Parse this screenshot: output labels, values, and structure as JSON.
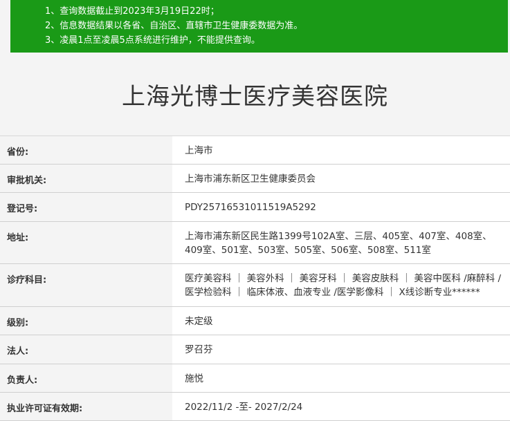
{
  "notice": {
    "lines": [
      "1、查询数据截止到2023年3月19日22时；",
      "2、信息数据结果以各省、自治区、直辖市卫生健康委数据为准。",
      "3、凌晨1点至凌晨5点系统进行维护，不能提供查询。"
    ]
  },
  "title": "上海光博士医疗美容医院",
  "rows": [
    {
      "label": "省份:",
      "value": "上海市"
    },
    {
      "label": "审批机关:",
      "value": "上海市浦东新区卫生健康委员会"
    },
    {
      "label": "登记号:",
      "value": "PDY25716531011519A5292"
    },
    {
      "label": "地址:",
      "value": "上海市浦东新区民生路1399号102A室、三层、405室、407室、408室、409室、501室、503室、505室、506室、508室、511室"
    },
    {
      "label": "诊疗科目:",
      "value": "医疗美容科 ｜ 美容外科 ｜ 美容牙科 ｜ 美容皮肤科 ｜ 美容中医科 /麻醉科 /医学检验科 ｜ 临床体液、血液专业 /医学影像科 ｜ X线诊断专业******"
    },
    {
      "label": "级别:",
      "value": "未定级"
    },
    {
      "label": "法人:",
      "value": "罗召芬"
    },
    {
      "label": "负责人:",
      "value": "施悦"
    },
    {
      "label": "执业许可证有效期:",
      "value": "2022/11/2 -至- 2027/2/24"
    }
  ],
  "colors": {
    "notice_bg": "#1a9a17",
    "page_bg": "#f4f4f4"
  }
}
